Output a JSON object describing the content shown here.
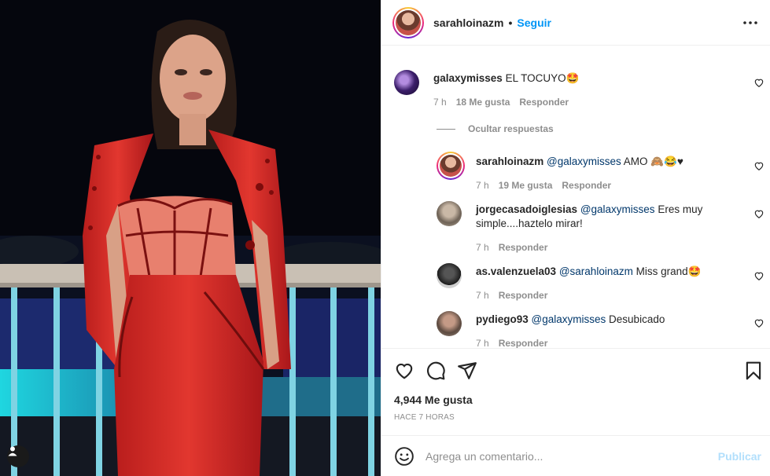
{
  "header": {
    "username": "sarahloinazm",
    "separator": "•",
    "follow_label": "Seguir"
  },
  "comments": [
    {
      "user": "galaxymisses",
      "text": "EL TOCUYO🤩",
      "time": "7 h",
      "likes": "18 Me gusta",
      "reply_label": "Responder"
    }
  ],
  "hide_replies_label": "Ocultar respuestas",
  "replies": [
    {
      "user": "sarahloinazm",
      "mention": "@galaxymisses",
      "text": "AMO 🙈😂♥",
      "time": "7 h",
      "likes": "19 Me gusta",
      "reply_label": "Responder"
    },
    {
      "user": "jorgecasadoiglesias",
      "mention": "@galaxymisses",
      "text": "Eres muy simple....haztelo mirar!",
      "time": "7 h",
      "reply_label": "Responder"
    },
    {
      "user": "as.valenzuela03",
      "mention": "@sarahloinazm",
      "text": "Miss grand🤩",
      "time": "7 h",
      "reply_label": "Responder"
    },
    {
      "user": "pydiego93",
      "mention": "@galaxymisses",
      "text": "Desubicado",
      "time": "7 h",
      "reply_label": "Responder"
    }
  ],
  "post": {
    "likes": "4,944 Me gusta",
    "time_ago": "HACE 7 HORAS"
  },
  "composer": {
    "placeholder": "Agrega un comentario...",
    "publish_label": "Publicar"
  },
  "colors": {
    "accent": "#0095f6",
    "publish_disabled": "#b2dffc",
    "muted": "#8e8e8e",
    "dress": "#d42a25"
  }
}
